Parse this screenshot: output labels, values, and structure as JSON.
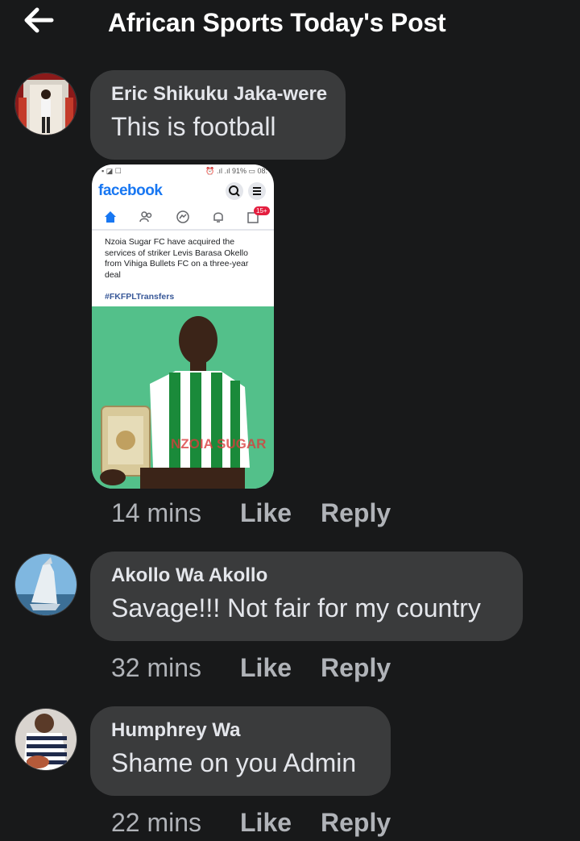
{
  "header": {
    "title": "African Sports Today's Post"
  },
  "comments": [
    {
      "author": "Eric Shikuku Jaka-were",
      "text": "This is football",
      "time": "14 mins",
      "like": "Like",
      "reply": "Reply",
      "attachment": {
        "app_name": "facebook",
        "status_left": "▪ ◪ ☐",
        "status_right": "⏰ .ıl  .ıl 91% ▭ 08:",
        "notification_badge": "15+",
        "post_text": "Nzoia Sugar FC have acquired the services of striker Levis Barasa Okello from Vihiga Bullets FC on a three-year deal",
        "hashtag": "#FKFPLTransfers",
        "jersey_text": "NZOIA SUGAR"
      }
    },
    {
      "author": "Akollo Wa Akollo",
      "text": "Savage!!! Not fair for my country",
      "time": "32 mins",
      "like": "Like",
      "reply": "Reply"
    },
    {
      "author": "Humphrey Wa",
      "text": "Shame on you Admin",
      "time": "22 mins",
      "like": "Like",
      "reply": "Reply"
    }
  ],
  "colors": {
    "background": "#18191a",
    "bubble": "#3a3b3c",
    "text_primary": "#e4e6eb",
    "text_secondary": "#b0b3b8",
    "facebook_blue": "#1877f2"
  }
}
